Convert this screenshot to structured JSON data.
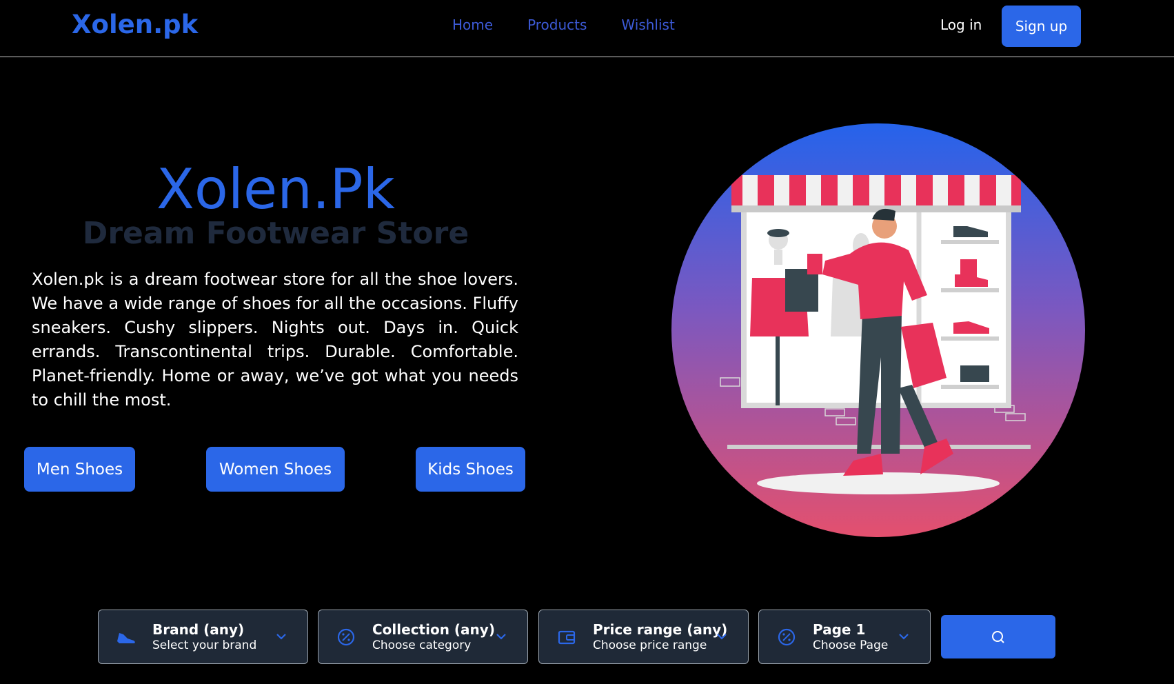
{
  "header": {
    "logo": "Xolen.pk",
    "nav": [
      "Home",
      "Products",
      "Wishlist"
    ],
    "login": "Log in",
    "signup": "Sign up"
  },
  "hero": {
    "title": "Xolen.Pk",
    "subtitle": "Dream Footwear Store",
    "description": "Xolen.pk is a dream footwear store for all the shoe lovers. We have a wide range of shoes for all the occasions. Fluffy sneakers. Cushy slippers. Nights out. Days in. Quick errands. Transcontinental trips. Durable. Comfortable. Planet-friendly. Home or away, we’ve got what you needs to chill the most.",
    "buttons": [
      "Men Shoes",
      "Women Shoes",
      "Kids Shoes"
    ]
  },
  "filters": [
    {
      "title": "Brand (any)",
      "sub": "Select your brand",
      "icon": "shoe-icon"
    },
    {
      "title": "Collection (any)",
      "sub": "Choose category",
      "icon": "percent-badge-icon"
    },
    {
      "title": "Price range (any)",
      "sub": "Choose price range",
      "icon": "wallet-icon"
    },
    {
      "title": "Page 1",
      "sub": "Choose Page",
      "icon": "percent-badge-icon"
    }
  ],
  "search": {
    "icon": "search-icon"
  },
  "colors": {
    "accent": "#2b67e8",
    "nav_link": "#3d5bd9",
    "pink": "#e8325a",
    "panel": "#1f2937"
  }
}
